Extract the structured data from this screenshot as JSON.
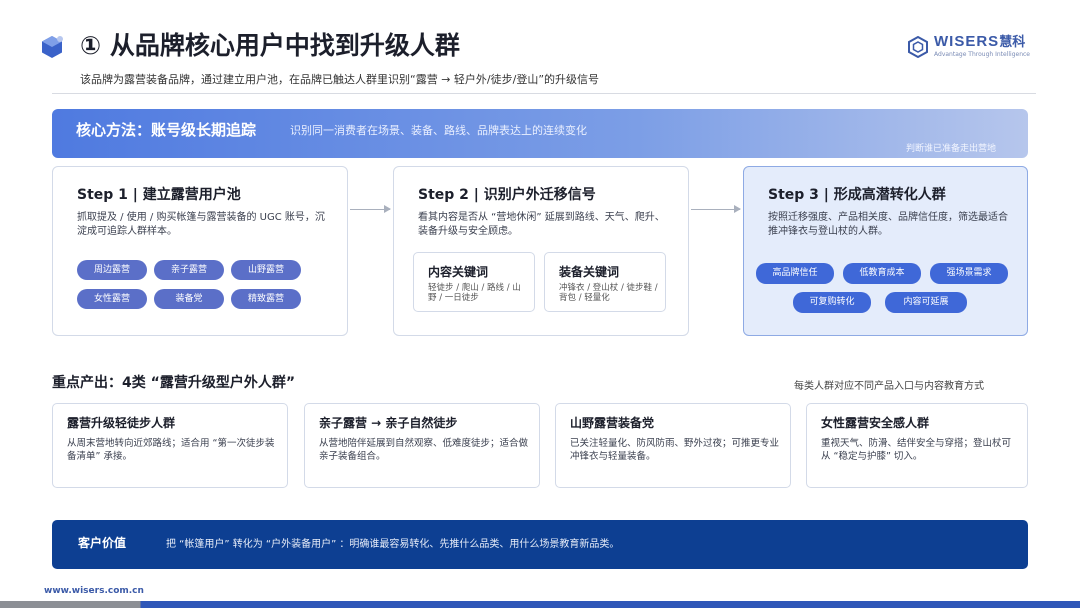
{
  "header": {
    "title": "① 从品牌核心用户中找到升级人群",
    "subtitle": "该品牌为露营装备品牌，通过建立用户池，在品牌已触达人群里识别“露营 → 轻户外/徒步/登山”的升级信号",
    "brand_name": "WISERS",
    "brand_name_cn": "慧科",
    "brand_tagline": "Advantage Through Intelligence"
  },
  "banner": {
    "title": "核心方法：账号级长期追踪",
    "desc": "识别同一消费者在场景、装备、路线、品牌表达上的连续变化",
    "note": "判断谁已准备走出营地"
  },
  "steps": [
    {
      "title": "Step 1 | 建立露营用户池",
      "desc": "抓取提及 / 使用 / 购买帐篷与露营装备的 UGC 账号，沉淀成可追踪人群样本。",
      "tags": [
        "周边露营",
        "亲子露营",
        "山野露营",
        "女性露营",
        "装备党",
        "精致露营"
      ]
    },
    {
      "title": "Step 2 | 识别户外迁移信号",
      "desc": "看其内容是否从 “营地休闲” 延展到路线、天气、爬升、装备升级与安全顾虑。",
      "boxes": [
        {
          "title": "内容关键词",
          "body": "轻徒步 / 爬山 / 路线 / 山野 / 一日徒步"
        },
        {
          "title": "装备关键词",
          "body": "冲锋衣 / 登山杖 / 徒步鞋 / 背包 / 轻量化"
        }
      ]
    },
    {
      "title": "Step 3 | 形成高潜转化人群",
      "desc": "按照迁移强度、产品相关度、品牌信任度，筛选最适合推冲锋衣与登山杖的人群。",
      "tags": [
        "高品牌信任",
        "低教育成本",
        "强场景需求",
        "可复购转化",
        "内容可延展"
      ]
    }
  ],
  "output": {
    "title": "重点产出：4类 “露营升级型户外人群”",
    "note": "每类人群对应不同产品入口与内容教育方式",
    "cards": [
      {
        "title": "露营升级轻徒步人群",
        "desc": "从周末营地转向近郊路线；适合用 “第一次徒步装备清单” 承接。"
      },
      {
        "title": "亲子露营 → 亲子自然徒步",
        "desc": "从营地陪伴延展到自然观察、低难度徒步；适合做亲子装备组合。"
      },
      {
        "title": "山野露营装备党",
        "desc": "已关注轻量化、防风防雨、野外过夜；可推更专业冲锋衣与轻量装备。"
      },
      {
        "title": "女性露营安全感人群",
        "desc": "重视天气、防滑、结伴安全与穿搭；登山杖可从 “稳定与护膝” 切入。"
      }
    ]
  },
  "value": {
    "label": "客户价值",
    "text": "把 “帐篷用户” 转化为 “户外装备用户” ：明确谁最容易转化、先推什么品类、用什么场景教育新品类。"
  },
  "footer": {
    "url": "www.wisers.com.cn"
  },
  "colors": {
    "accent": "#4f7ae0",
    "pill": "#5b6fc8",
    "pill_step3": "#3f68d8",
    "value_bar": "#0d3f92"
  }
}
